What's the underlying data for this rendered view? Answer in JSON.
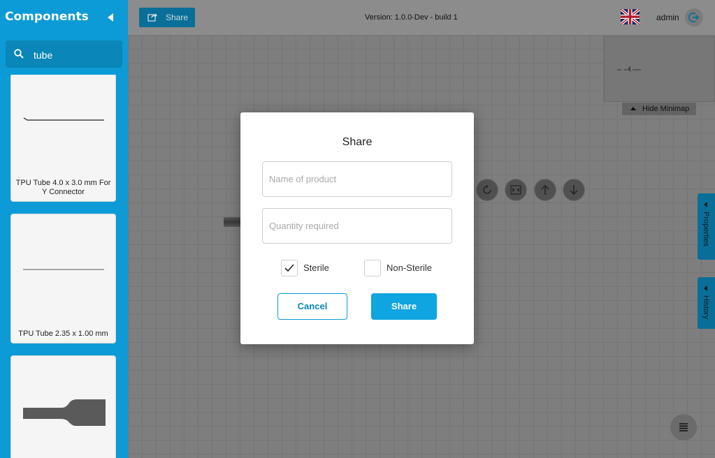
{
  "sidebar": {
    "title": "Components",
    "search": {
      "value": "tube",
      "placeholder": ""
    },
    "items": [
      {
        "label": "TPU Tube 4.0 x 3.0 mm For Y Connector"
      },
      {
        "label": "TPU Tube 2.35 x 1.00 mm"
      },
      {
        "label": ""
      }
    ]
  },
  "topbar": {
    "share_label": "Share",
    "version": "Version: 1.0.0-Dev - build 1",
    "user": "admin"
  },
  "canvas": {
    "hide_minimap_label": "Hide Minimap",
    "tabs": {
      "properties": "Properties",
      "history": "History"
    }
  },
  "modal": {
    "title": "Share",
    "name_placeholder": "Name of product",
    "quantity_placeholder": "Quantity required",
    "sterile_label": "Sterile",
    "sterile_checked": true,
    "non_sterile_label": "Non-Sterile",
    "non_sterile_checked": false,
    "cancel_label": "Cancel",
    "share_label": "Share"
  },
  "colors": {
    "sidebar": "#0c9bd6",
    "primary_button": "#0ea5e0",
    "overlay_canvas": "#7e7e7e"
  }
}
